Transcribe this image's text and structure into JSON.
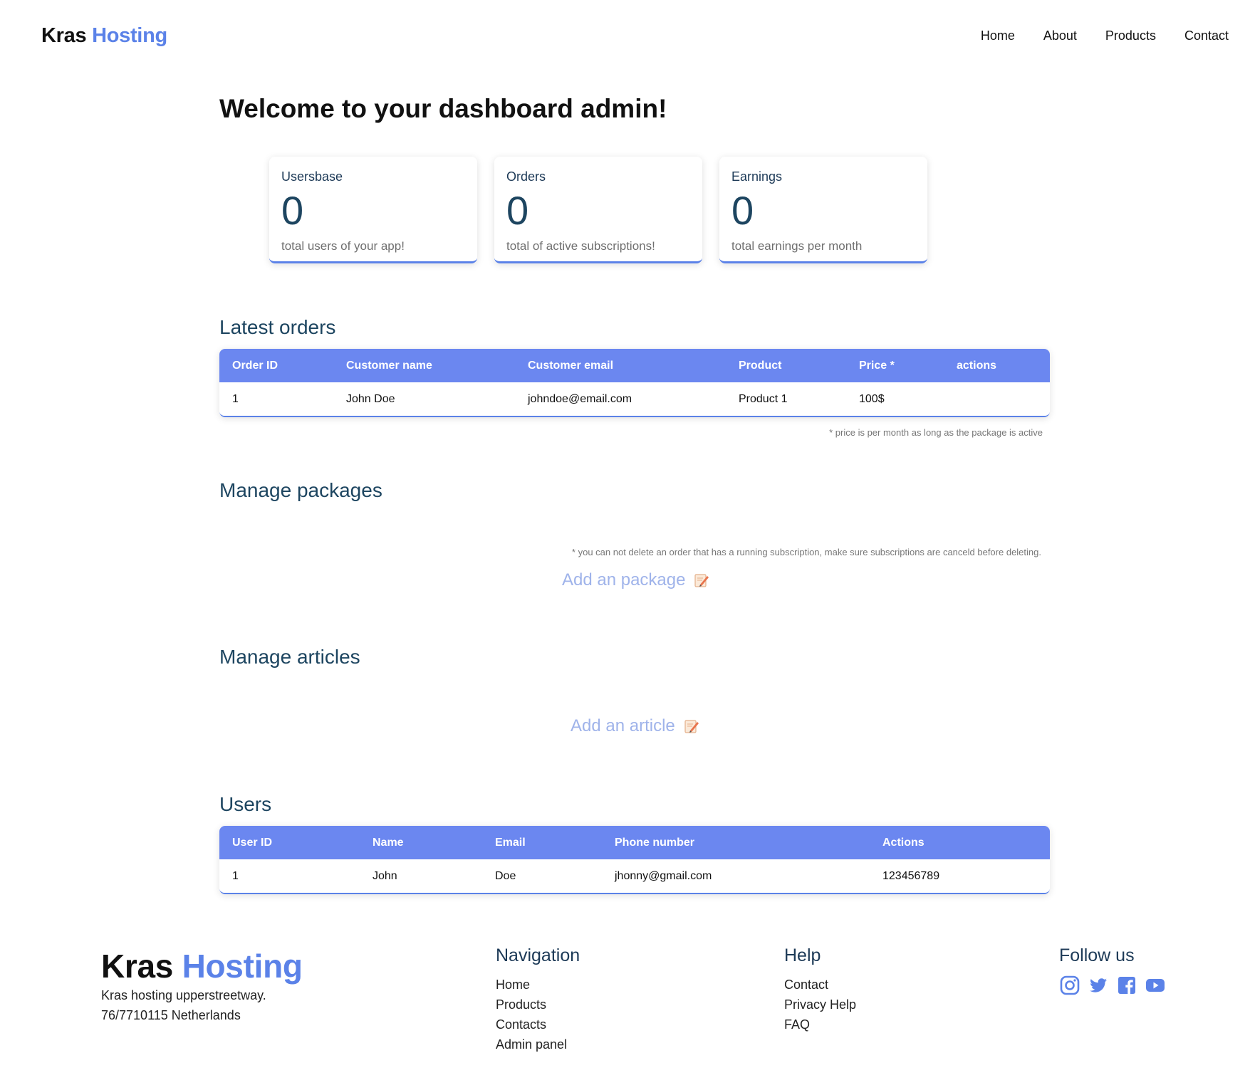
{
  "header": {
    "brand_primary": "Kras",
    "brand_accent": "Hosting",
    "nav": [
      "Home",
      "About",
      "Products",
      "Contact"
    ]
  },
  "welcome": "Welcome to your dashboard admin!",
  "stats": [
    {
      "label": "Usersbase",
      "value": "0",
      "desc": "total users of your app!"
    },
    {
      "label": "Orders",
      "value": "0",
      "desc": "total of active subscriptions!"
    },
    {
      "label": "Earnings",
      "value": "0",
      "desc": "total earnings per month"
    }
  ],
  "orders": {
    "title": "Latest orders",
    "columns": [
      "Order ID",
      "Customer name",
      "Customer email",
      "Product",
      "Price *",
      "actions"
    ],
    "rows": [
      [
        "1",
        "John Doe",
        "johndoe@email.com",
        "Product 1",
        "100$",
        ""
      ]
    ],
    "note": "* price is per month as long as the package is active"
  },
  "packages": {
    "title": "Manage packages",
    "note": "* you can not delete an order that has a running subscription, make sure subscriptions are canceld before deleting.",
    "add_label": "Add an package"
  },
  "articles": {
    "title": "Manage articles",
    "add_label": "Add an article"
  },
  "users": {
    "title": "Users",
    "columns": [
      "User ID",
      "Name",
      "Email",
      "Phone number",
      "Actions"
    ],
    "rows": [
      [
        "1",
        "John",
        "Doe",
        "jhonny@gmail.com",
        "123456789"
      ]
    ]
  },
  "footer": {
    "brand_primary": "Kras",
    "brand_accent": "Hosting",
    "address_line1": "Kras hosting upperstreetway.",
    "address_line2": "76/7710115 Netherlands",
    "navigation": {
      "title": "Navigation",
      "links": [
        "Home",
        "Products",
        "Contacts",
        "Admin panel"
      ]
    },
    "help": {
      "title": "Help",
      "links": [
        "Contact",
        "Privacy Help",
        "FAQ"
      ]
    },
    "follow": {
      "title": "Follow us",
      "icons": [
        "instagram-icon",
        "twitter-icon",
        "facebook-icon",
        "youtube-icon"
      ]
    }
  },
  "colors": {
    "accent": "#5b82e8",
    "table_header": "#6b87f0",
    "heading": "#1d4560",
    "link_muted": "#9fb3ea"
  }
}
